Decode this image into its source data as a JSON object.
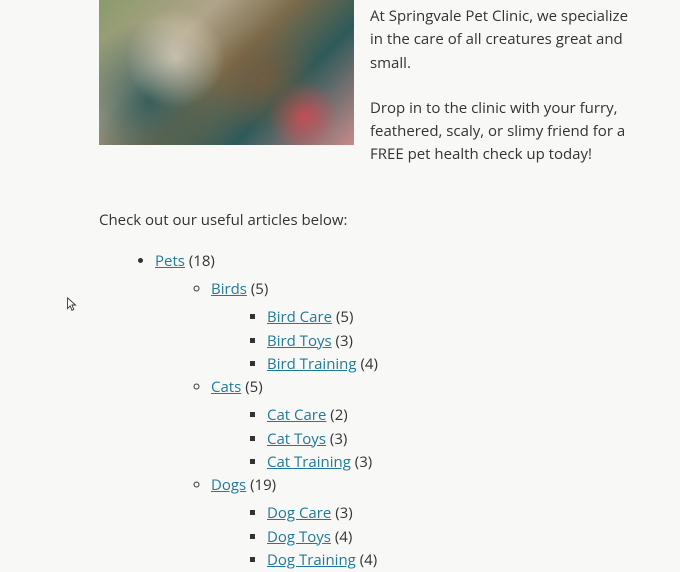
{
  "hero": {
    "p1": "At Springvale Pet Clinic, we specialize in the care of all creatures great and small.",
    "p2": "Drop in to the clinic with your furry, feathered, scaly, or slimy friend for a FREE pet health check up today!"
  },
  "articles_intro": "Check out our useful articles below:",
  "cats": {
    "pets": {
      "label": "Pets",
      "count": "(18)"
    },
    "birds": {
      "label": "Birds",
      "count": "(5)"
    },
    "bird_care": {
      "label": "Bird Care",
      "count": "(5)"
    },
    "bird_toys": {
      "label": "Bird Toys",
      "count": "(3)"
    },
    "bird_training": {
      "label": "Bird Training",
      "count": "(4)"
    },
    "cats_c": {
      "label": "Cats",
      "count": "(5)"
    },
    "cat_care": {
      "label": "Cat Care",
      "count": "(2)"
    },
    "cat_toys": {
      "label": "Cat Toys",
      "count": "(3)"
    },
    "cat_training": {
      "label": "Cat Training",
      "count": "(3)"
    },
    "dogs": {
      "label": "Dogs",
      "count": "(19)"
    },
    "dog_care": {
      "label": "Dog Care",
      "count": "(3)"
    },
    "dog_toys": {
      "label": "Dog Toys",
      "count": "(4)"
    },
    "dog_training": {
      "label": "Dog Training",
      "count": "(4)"
    }
  }
}
